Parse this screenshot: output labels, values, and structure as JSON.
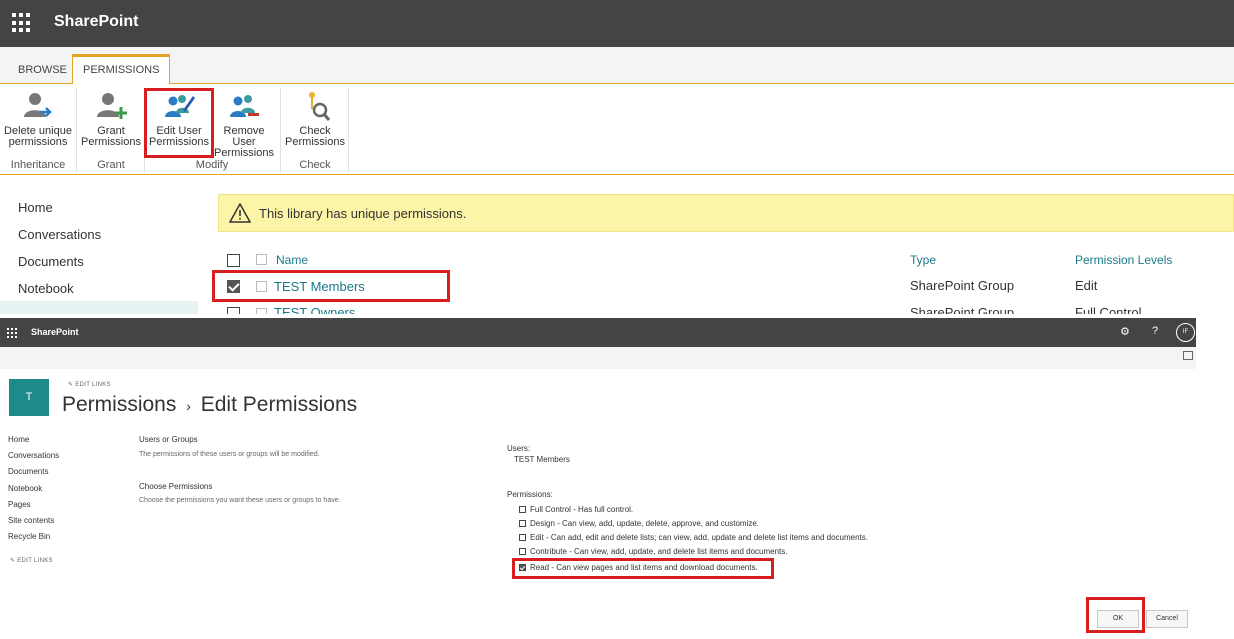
{
  "top": {
    "app_name": "SharePoint",
    "tabs": [
      "BROWSE",
      "PERMISSIONS"
    ],
    "ribbon": {
      "buttons": [
        {
          "line1": "Delete unique",
          "line2": "permissions",
          "icon": "delete-unique-permissions-icon"
        },
        {
          "line1": "Grant",
          "line2": "Permissions",
          "icon": "grant-permissions-icon"
        },
        {
          "line1": "Edit User",
          "line2": "Permissions",
          "icon": "edit-user-permissions-icon"
        },
        {
          "line1": "Remove User",
          "line2": "Permissions",
          "icon": "remove-user-permissions-icon"
        },
        {
          "line1": "Check",
          "line2": "Permissions",
          "icon": "check-permissions-icon"
        }
      ],
      "groups": [
        "Inheritance",
        "Grant",
        "Modify",
        "Check"
      ]
    },
    "nav": [
      "Home",
      "Conversations",
      "Documents",
      "Notebook"
    ],
    "banner": "This library has unique permissions.",
    "table": {
      "headers": {
        "name": "Name",
        "type": "Type",
        "levels": "Permission Levels"
      },
      "rows": [
        {
          "name": "TEST Members",
          "type": "SharePoint Group",
          "level": "Edit",
          "checked": true
        },
        {
          "name": "TEST Owners",
          "type": "SharePoint Group",
          "level": "Full Control",
          "checked": false
        }
      ]
    }
  },
  "bottom": {
    "app_name": "SharePoint",
    "avatar_initials": "IF",
    "site_initial": "T",
    "edit_links": "EDIT LINKS",
    "title_part1": "Permissions",
    "title_sep": "›",
    "title_part2": "Edit Permissions",
    "nav": [
      "Home",
      "Conversations",
      "Documents",
      "Notebook",
      "Pages",
      "Site contents",
      "Recycle Bin"
    ],
    "users_section": {
      "title": "Users or Groups",
      "desc": "The permissions of these users or groups will be modified."
    },
    "choose_section": {
      "title": "Choose Permissions",
      "desc": "Choose the permissions you want these users or groups to have."
    },
    "users_label": "Users:",
    "users_value": "TEST Members",
    "permissions_label": "Permissions:",
    "permissions": [
      {
        "text": "Full Control - Has full control.",
        "checked": false
      },
      {
        "text": "Design - Can view, add, update, delete, approve, and customize.",
        "checked": false
      },
      {
        "text": "Edit - Can add, edit and delete lists; can view, add, update and delete list items and documents.",
        "checked": false
      },
      {
        "text": "Contribute - Can view, add, update, and delete list items and documents.",
        "checked": false
      },
      {
        "text": "Read - Can view pages and list items and download documents.",
        "checked": true
      }
    ],
    "ok_label": "OK",
    "cancel_label": "Cancel"
  }
}
